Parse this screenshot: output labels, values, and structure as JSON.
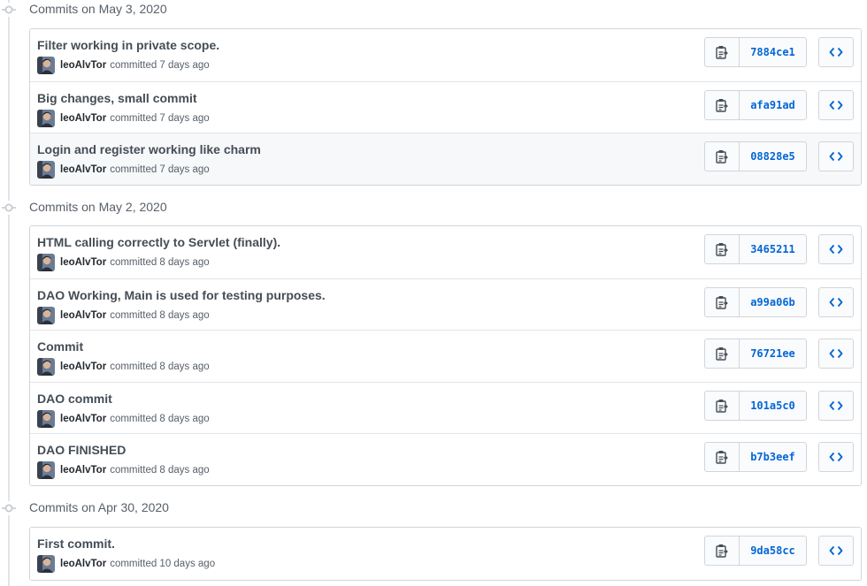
{
  "groups": [
    {
      "date_label": "Commits on May 3, 2020",
      "commits": [
        {
          "title": "Filter working in private scope.",
          "author": "leoAlvTor",
          "action": "committed 7 days ago",
          "sha": "7884ce1",
          "highlighted": false
        },
        {
          "title": "Big changes, small commit",
          "author": "leoAlvTor",
          "action": "committed 7 days ago",
          "sha": "afa91ad",
          "highlighted": false
        },
        {
          "title": "Login and register working like charm",
          "author": "leoAlvTor",
          "action": "committed 7 days ago",
          "sha": "08828e5",
          "highlighted": true
        }
      ]
    },
    {
      "date_label": "Commits on May 2, 2020",
      "commits": [
        {
          "title": "HTML calling correctly to Servlet (finally).",
          "author": "leoAlvTor",
          "action": "committed 8 days ago",
          "sha": "3465211",
          "highlighted": false
        },
        {
          "title": "DAO Working, Main is used for testing purposes.",
          "author": "leoAlvTor",
          "action": "committed 8 days ago",
          "sha": "a99a06b",
          "highlighted": false
        },
        {
          "title": "Commit",
          "author": "leoAlvTor",
          "action": "committed 8 days ago",
          "sha": "76721ee",
          "highlighted": false
        },
        {
          "title": "DAO commit",
          "author": "leoAlvTor",
          "action": "committed 8 days ago",
          "sha": "101a5c0",
          "highlighted": false
        },
        {
          "title": "DAO FINISHED",
          "author": "leoAlvTor",
          "action": "committed 8 days ago",
          "sha": "b7b3eef",
          "highlighted": false
        }
      ]
    },
    {
      "date_label": "Commits on Apr 30, 2020",
      "commits": [
        {
          "title": "First commit.",
          "author": "leoAlvTor",
          "action": "committed 10 days ago",
          "sha": "9da58cc",
          "highlighted": false
        }
      ]
    }
  ],
  "icons": {
    "timeline": "git-commit-icon",
    "copy": "clippy-icon",
    "browse": "code-icon"
  },
  "colors": {
    "link_blue": "#0366d6",
    "muted_text": "#586069",
    "title_text": "#444d56",
    "border": "#d1d5da",
    "highlight_row": "#f6f8fa"
  }
}
